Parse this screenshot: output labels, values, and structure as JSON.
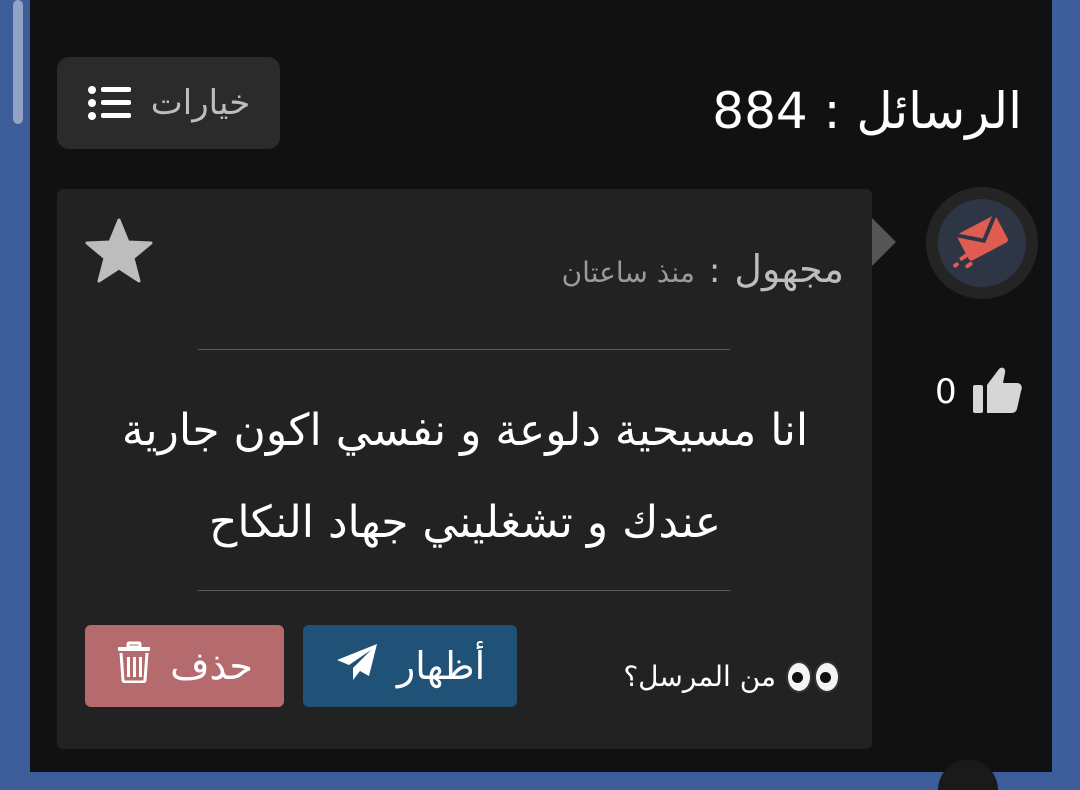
{
  "header": {
    "title": "الرسائل : 884"
  },
  "toolbar": {
    "options_label": "خيارات",
    "options_icon": "list-icon"
  },
  "message_card": {
    "sender": "مجهول",
    "separator": ":",
    "time": "منذ ساعتان",
    "body": "انا مسيحية دلوعة و نفسي اكون جارية عندك و تشغليني جهاد النكاح",
    "who_sent_label": "من المرسل؟",
    "eyes_icon": "eyes-icon",
    "show_label": "أظهار",
    "show_icon": "paper-plane-icon",
    "delete_label": "حذف",
    "delete_icon": "trash-icon",
    "star_icon": "star-icon"
  },
  "likes": {
    "count": "0",
    "icon": "thumbs-up-icon"
  },
  "colors": {
    "background": "#111111",
    "card": "#222222",
    "frame": "#3d5e9b",
    "show_button": "#1f5276",
    "delete_button": "#b56b6d",
    "avatar_accent": "#e05b50"
  }
}
